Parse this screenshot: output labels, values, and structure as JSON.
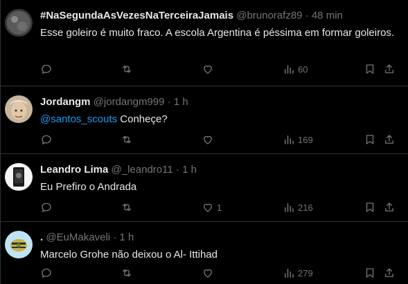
{
  "tweets": [
    {
      "name": "#NaSegundaAsVezesNaTerceiraJamais",
      "handle": "@brunorafz89",
      "time": "48 min",
      "text": "Esse goleiro é muito fraco. A escola Argentina é péssima em formar goleiros.",
      "mention": "",
      "likes": "",
      "views": "60"
    },
    {
      "name": "Jordangm",
      "handle": "@jordangm999",
      "time": "1 h",
      "mention": "@santos_scouts",
      "text": " Conheçe?",
      "likes": "",
      "views": "169"
    },
    {
      "name": "Leandro Lima",
      "handle": "@_leandro11",
      "time": "1 h",
      "mention": "",
      "text": "Eu Prefiro o Andrada",
      "likes": "1",
      "views": "216"
    },
    {
      "name": ".",
      "handle": "@EuMakaveli",
      "time": "1 h",
      "mention": "",
      "text": "Marcelo Grohe não deixou o Al- Ittihad",
      "likes": "",
      "views": "279"
    }
  ],
  "separator": "·",
  "colors": {
    "background": "#000000",
    "text": "#e7e9ea",
    "muted": "#71767b",
    "link": "#1d9bf0",
    "border": "#2f3336"
  },
  "icons": [
    "reply-icon",
    "retweet-icon",
    "like-icon",
    "views-icon",
    "bookmark-icon",
    "share-icon"
  ]
}
